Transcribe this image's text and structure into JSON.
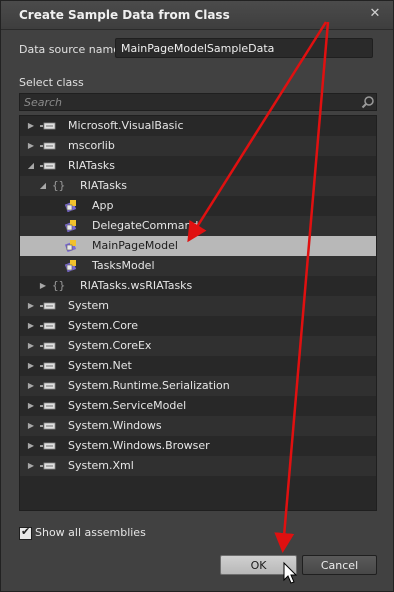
{
  "window": {
    "title": "Create Sample Data from Class",
    "close_glyph": "✕"
  },
  "datasource": {
    "label": "Data source name",
    "value": "MainPageModelSampleData"
  },
  "select_class": {
    "label": "Select class",
    "search_placeholder": "Search",
    "items": [
      {
        "label": "Microsoft.VisualBasic",
        "level": 0,
        "expander": "collapsed",
        "icon": "assembly-icon"
      },
      {
        "label": "mscorlib",
        "level": 0,
        "expander": "collapsed",
        "icon": "assembly-icon"
      },
      {
        "label": "RIATasks",
        "level": 0,
        "expander": "expanded",
        "icon": "assembly-icon"
      },
      {
        "label": "RIATasks",
        "level": 1,
        "expander": "expanded",
        "icon": "namespace-icon"
      },
      {
        "label": "App",
        "level": 2,
        "expander": "none",
        "icon": "class-icon"
      },
      {
        "label": "DelegateCommand",
        "level": 2,
        "expander": "none",
        "icon": "class-icon"
      },
      {
        "label": "MainPageModel",
        "level": 2,
        "expander": "none",
        "icon": "class-icon",
        "selected": true
      },
      {
        "label": "TasksModel",
        "level": 2,
        "expander": "none",
        "icon": "class-icon"
      },
      {
        "label": "RIATasks.wsRIATasks",
        "level": 1,
        "expander": "collapsed",
        "icon": "namespace-icon"
      },
      {
        "label": "System",
        "level": 0,
        "expander": "collapsed",
        "icon": "assembly-icon"
      },
      {
        "label": "System.Core",
        "level": 0,
        "expander": "collapsed",
        "icon": "assembly-icon"
      },
      {
        "label": "System.CoreEx",
        "level": 0,
        "expander": "collapsed",
        "icon": "assembly-icon"
      },
      {
        "label": "System.Net",
        "level": 0,
        "expander": "collapsed",
        "icon": "assembly-icon"
      },
      {
        "label": "System.Runtime.Serialization",
        "level": 0,
        "expander": "collapsed",
        "icon": "assembly-icon"
      },
      {
        "label": "System.ServiceModel",
        "level": 0,
        "expander": "collapsed",
        "icon": "assembly-icon"
      },
      {
        "label": "System.Windows",
        "level": 0,
        "expander": "collapsed",
        "icon": "assembly-icon"
      },
      {
        "label": "System.Windows.Browser",
        "level": 0,
        "expander": "collapsed",
        "icon": "assembly-icon"
      },
      {
        "label": "System.Xml",
        "level": 0,
        "expander": "collapsed",
        "icon": "assembly-icon"
      }
    ]
  },
  "show_all": {
    "label": "Show all assemblies",
    "checked": true
  },
  "buttons": {
    "ok": "OK",
    "cancel": "Cancel"
  },
  "colors": {
    "dialog_bg": "#414141",
    "selection": "#b8b8b8",
    "annotation_arrow": "#e01010"
  }
}
